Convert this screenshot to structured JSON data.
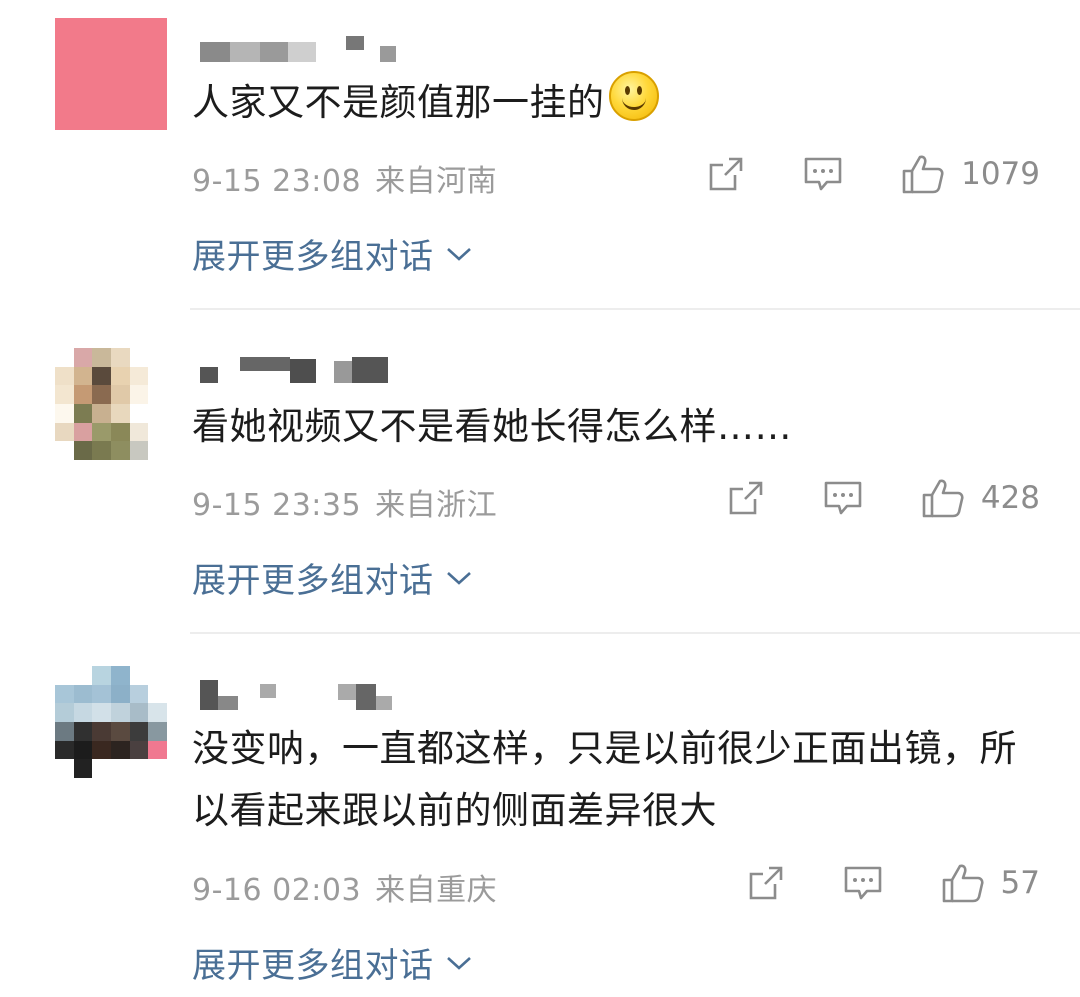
{
  "comments": [
    {
      "text": "人家又不是颜值那一挂的",
      "emoji": "smile-emoji",
      "date": "9-15 23:08",
      "location": "来自河南",
      "likes": "1079",
      "expand_label": "展开更多组对话"
    },
    {
      "text": "看她视频又不是看她长得怎么样……",
      "date": "9-15 23:35",
      "location": "来自浙江",
      "likes": "428",
      "expand_label": "展开更多组对话"
    },
    {
      "text": "没变呐，一直都这样，只是以前很少正面出镜，所以看起来跟以前的侧面差异很大",
      "date": "9-16 02:03",
      "location": "来自重庆",
      "likes": "57",
      "expand_label": "展开更多组对话"
    }
  ],
  "colors": {
    "meta": "#9b9b9b",
    "link": "#4a6f95",
    "text": "#1c1c1c",
    "divider": "#ededed"
  }
}
